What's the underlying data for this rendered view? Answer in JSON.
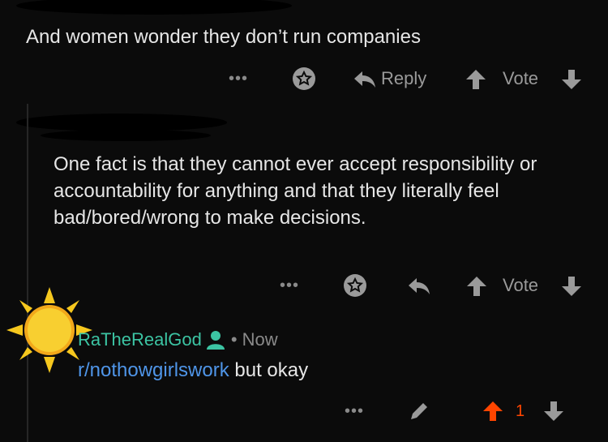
{
  "comment1": {
    "body": "And women wonder they don’t run companies",
    "actions": {
      "more": "•••",
      "reply": "Reply",
      "vote": "Vote"
    }
  },
  "comment2": {
    "body": "One fact is that they cannot ever accept responsibility or accountability for anything and that they literally feel bad/bored/wrong to make decisions.",
    "actions": {
      "more": "•••",
      "vote": "Vote"
    }
  },
  "comment3": {
    "author": "RaTheRealGod",
    "separator": "•",
    "time": "Now",
    "subreddit_link": "r/nothowgirlswork",
    "body_rest": " but okay",
    "actions": {
      "more": "•••",
      "score": "1"
    }
  },
  "colors": {
    "upvoted": "#ff4500",
    "username": "#3cc4a3",
    "link": "#4f95e8"
  }
}
